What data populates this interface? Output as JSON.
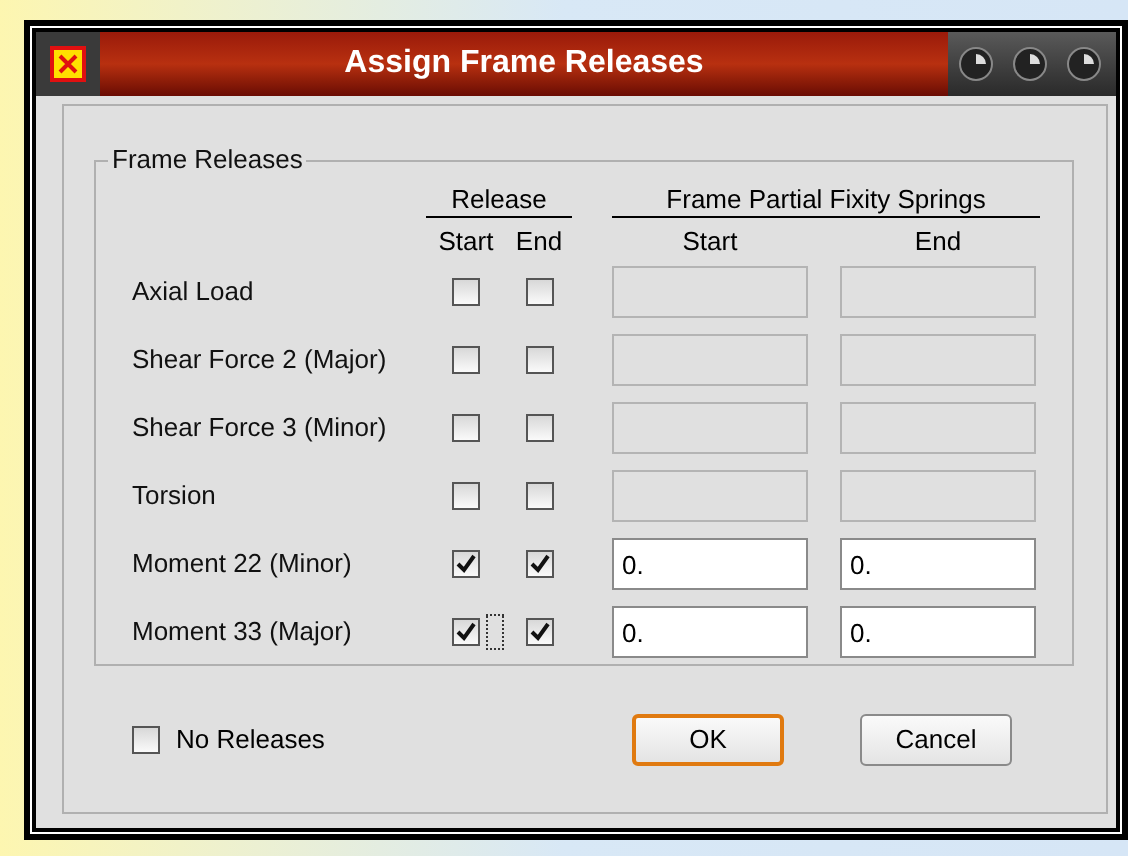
{
  "window": {
    "title": "Assign Frame Releases"
  },
  "group": {
    "title": "Frame Releases"
  },
  "headers": {
    "release": "Release",
    "springs": "Frame Partial Fixity Springs",
    "release_start": "Start",
    "release_end": "End",
    "spring_start": "Start",
    "spring_end": "End"
  },
  "rows": [
    {
      "label": "Axial Load",
      "start_checked": false,
      "end_checked": false,
      "start_focused": false,
      "spring_start": {
        "disabled": true
      },
      "spring_end": {
        "disabled": true
      }
    },
    {
      "label": "Shear Force 2 (Major)",
      "start_checked": false,
      "end_checked": false,
      "start_focused": false,
      "spring_start": {
        "disabled": true
      },
      "spring_end": {
        "disabled": true
      }
    },
    {
      "label": "Shear Force 3 (Minor)",
      "start_checked": false,
      "end_checked": false,
      "start_focused": false,
      "spring_start": {
        "disabled": true
      },
      "spring_end": {
        "disabled": true
      }
    },
    {
      "label": "Torsion",
      "start_checked": false,
      "end_checked": false,
      "start_focused": false,
      "spring_start": {
        "disabled": true
      },
      "spring_end": {
        "disabled": true
      }
    },
    {
      "label": "Moment 22 (Minor)",
      "start_checked": true,
      "end_checked": true,
      "start_focused": false,
      "spring_start": {
        "value": "0.",
        "disabled": false
      },
      "spring_end": {
        "value": "0.",
        "disabled": false
      }
    },
    {
      "label": "Moment 33 (Major)",
      "start_checked": true,
      "end_checked": true,
      "start_focused": true,
      "spring_start": {
        "value": "0.",
        "disabled": false
      },
      "spring_end": {
        "value": "0.",
        "disabled": false
      }
    }
  ],
  "no_releases": {
    "label": "No Releases",
    "checked": false
  },
  "buttons": [
    {
      "label": "OK",
      "default": true
    },
    {
      "label": "Cancel",
      "default": false
    }
  ]
}
